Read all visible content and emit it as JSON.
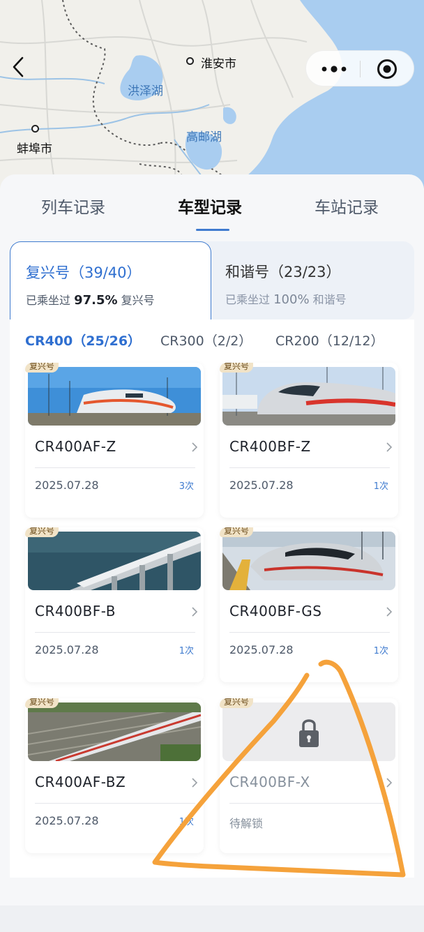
{
  "map": {
    "cities": [
      {
        "name": "淮安市"
      },
      {
        "name": "蚌埠市"
      }
    ],
    "lakes": [
      {
        "name": "洪泽湖"
      },
      {
        "name": "高邮湖"
      }
    ]
  },
  "nav": {
    "back_icon": "chevron-left-icon",
    "more_icon": "more-dots-icon",
    "close_icon": "target-icon"
  },
  "tabs": {
    "items": [
      "列车记录",
      "车型记录",
      "车站记录"
    ],
    "active": 1
  },
  "groups": [
    {
      "title": "复兴号（39/40）",
      "sub_prefix": "已乘坐过",
      "percent": "97.5%",
      "sub_suffix": "复兴号"
    },
    {
      "title": "和谐号（23/23）",
      "sub_prefix": "已乘坐过",
      "percent": "100%",
      "sub_suffix": "和谐号"
    }
  ],
  "sub_tabs": [
    "CR400（25/26）",
    "CR300（2/2）",
    "CR200（12/12）"
  ],
  "badge": "复兴号",
  "cards": [
    {
      "model": "CR400AF-Z",
      "date": "2025.07.28",
      "count": "3次"
    },
    {
      "model": "CR400BF-Z",
      "date": "2025.07.28",
      "count": "1次"
    },
    {
      "model": "CR400BF-B",
      "date": "2025.07.28",
      "count": "1次"
    },
    {
      "model": "CR400BF-GS",
      "date": "2025.07.28",
      "count": "1次"
    },
    {
      "model": "CR400AF-BZ",
      "date": "2025.07.28",
      "count": "1次"
    },
    {
      "model": "CR400BF-X",
      "date": "待解锁",
      "count": ""
    }
  ],
  "colors": {
    "accent": "#3f7bcf",
    "annotation": "#f5a23b",
    "badge_bg": "#f1e3c7"
  }
}
